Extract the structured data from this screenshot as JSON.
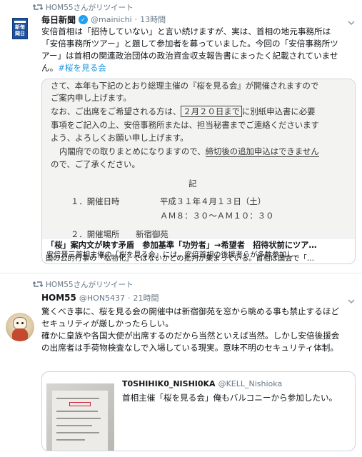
{
  "tweets": [
    {
      "retweet_label": "HOM55さんがリツイート",
      "author_name": "毎日新聞",
      "handle": "@mainichi",
      "separator": "·",
      "time": "13時間",
      "avatar_text": "新毎聞日",
      "body_lines": [
        "安倍首相は「招待していない」と言い続けますが、実は、首相の地元事務所は",
        "「安倍事務所ツアー」と題して参加者を募っていました。今回の「安倍事務所ツ",
        "アー」は首相の関連政治団体の政治資金収支報告書にまったく記載されていませ",
        "ん。"
      ],
      "hashtag": "#桜を見る会",
      "card": {
        "doc_lines": [
          "さて、本年も下記のとおり総理主催の『桜を見る会』が開催されますので",
          "ご案内申し上げます。",
          "なお、ご出席をご希望される方は、",
          "２月２０日まで",
          "に別紙申込書に必要",
          "事項をご記入の上、安倍事務所または、担当秘書までご連絡くださいます",
          "よう、よろしくお願い申し上げます。",
          "内閣府での取りまとめになりますので、",
          "締切後の追加申込はできません",
          "ので、ご了承ください。",
          "記",
          "１．開催日時",
          "平成３１年４月１３日（土）",
          "ＡＭ８：３０～ＡＭ１０：３０",
          "２．開催場所　　新宿御苑"
        ],
        "title": "「桜」案内文が映す矛盾　参加基準「功労者」→希望者　招待状前にツア…",
        "description_lines": [
          "安倍晋三首相主催の「桜を見る会」には、安倍首相の後援者らが多数参加し、",
          "国の公的行事の「私物化」ではないかとの批判が集まっている。首相は国会で「…"
        ]
      }
    },
    {
      "retweet_label": "HOM55さんがリツイート",
      "author_name": "HOM55",
      "handle": "@HON5437",
      "separator": "·",
      "time": "21時間",
      "body_lines": [
        "驚くべき事に、桜を見る会の開催中は新宿御苑を窓から眺める事も禁止するほど",
        "セキュリティが厳しかったらしい。",
        "確かに皇族や各国大使が出席するのだから当然といえば当然。しかし安倍後援会",
        "の出席者は手荷物検査なしで入場している現実。意味不明のセキュリティ体制。"
      ],
      "quote": {
        "author_name": "T0SHIHIK0_NISHI0KA",
        "handle": "@KELL_Nishioka",
        "text": "首相主催「桜を見る会」俺もバルコニーから参加したい。"
      }
    }
  ],
  "colors": {
    "link": "#1b95e0",
    "verified": "#1da1f2",
    "muted": "#657786",
    "border": "#ccd6dd"
  },
  "icons": {
    "retweet": "retweet-icon",
    "verified": "verified-badge-icon",
    "chevron": "chevron-down-icon"
  }
}
